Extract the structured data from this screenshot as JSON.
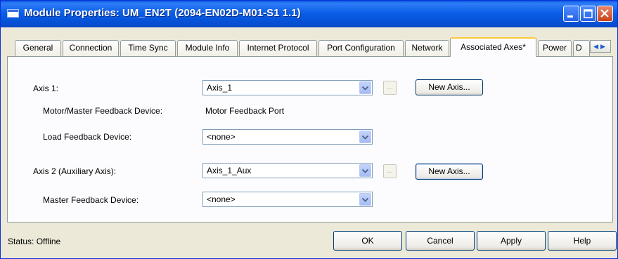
{
  "window": {
    "title": "Module Properties: UM_EN2T (2094-EN02D-M01-S1 1.1)",
    "icons": [
      "module-icon",
      "minimize-icon",
      "maximize-icon",
      "close-icon"
    ]
  },
  "tabs": [
    {
      "label": "General"
    },
    {
      "label": "Connection"
    },
    {
      "label": "Time Sync"
    },
    {
      "label": "Module Info"
    },
    {
      "label": "Internet Protocol"
    },
    {
      "label": "Port Configuration"
    },
    {
      "label": "Network"
    },
    {
      "label": "Associated Axes*",
      "active": true
    },
    {
      "label": "Power"
    },
    {
      "label": "D"
    }
  ],
  "form": {
    "axis1_label": "Axis 1:",
    "axis1_value": "Axis_1",
    "motor_feedback_label": "Motor/Master Feedback Device:",
    "motor_feedback_value": "Motor Feedback Port",
    "load_feedback_label": "Load Feedback Device:",
    "load_feedback_value": "<none>",
    "axis2_label": "Axis 2  (Auxiliary Axis):",
    "axis2_value": "Axis_1_Aux",
    "master_feedback_label": "Master Feedback Device:",
    "master_feedback_value": "<none>",
    "ellipsis_label": "...",
    "new_axis_label": "New Axis..."
  },
  "footer": {
    "status_label": "Status:",
    "status_value": "Offline",
    "ok_label": "OK",
    "cancel_label": "Cancel",
    "apply_label": "Apply",
    "help_label": "Help"
  },
  "colors": {
    "titlebar": "#0b5ee8",
    "dialog_bg": "#ece9d8",
    "active_tab_highlight": "#ffc83c",
    "close_button": "#c8421a"
  }
}
